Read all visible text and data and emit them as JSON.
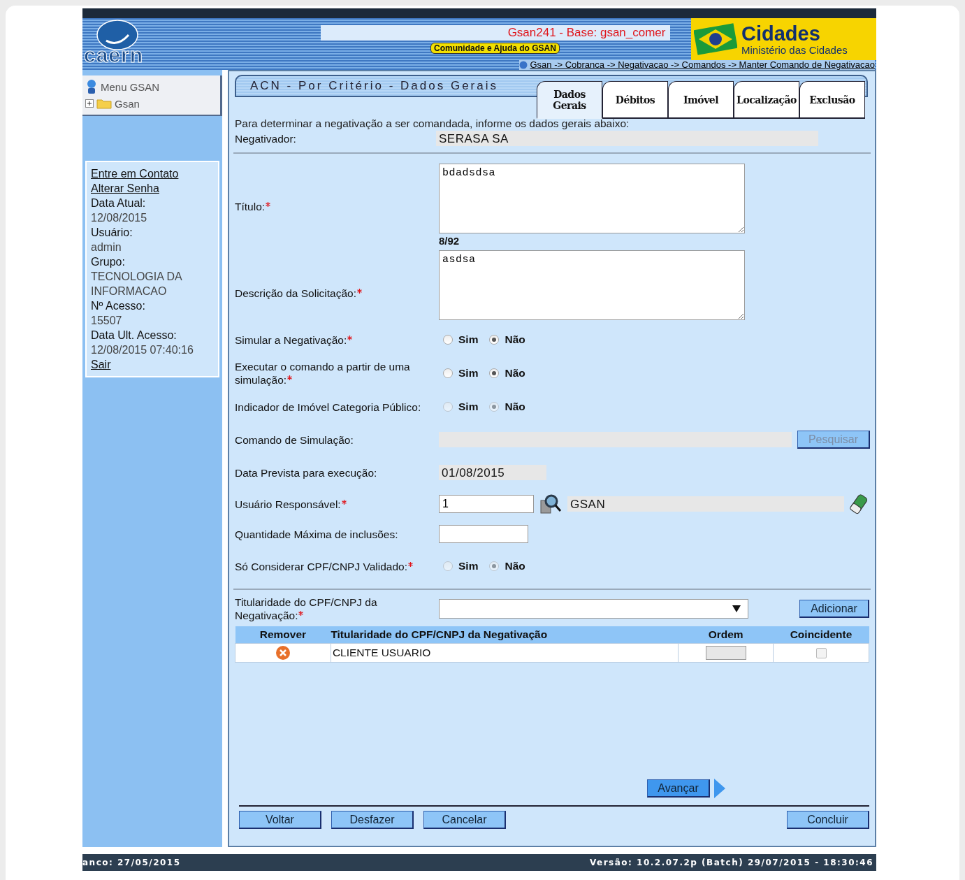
{
  "header": {
    "logo": "caern",
    "system_title": "Gsan241 - Base: gsan_comer",
    "help_link": "Comunidade e Ajuda do GSAN",
    "ministry_title": "Cidades",
    "ministry_subtitle": "Ministério das Cidades",
    "breadcrumb": "Gsan -> Cobranca -> Negativacao -> Comandos -> Manter Comando de Negativacao"
  },
  "sidebar": {
    "menu_title": "Menu GSAN",
    "tree": [
      {
        "label": "Gsan",
        "expanded": false
      }
    ],
    "links": [
      "Entre em Contato",
      "Alterar Senha"
    ],
    "info": [
      {
        "label": "Data Atual:",
        "value": "12/08/2015"
      },
      {
        "label": "Usuário:",
        "value": "admin"
      },
      {
        "label": "Grupo:",
        "value": "TECNOLOGIA DA INFORMACAO"
      },
      {
        "label": "Nº Acesso:",
        "value": "15507"
      },
      {
        "label": "Data Ult. Acesso:",
        "value": "12/08/2015 07:40:16"
      }
    ],
    "logout": "Sair"
  },
  "form": {
    "title": "ACN - Por Critério - Dados Gerais",
    "tabs": [
      {
        "label": "Dados Gerais",
        "selected": true
      },
      {
        "label": "Débitos",
        "selected": false
      },
      {
        "label": "Imóvel",
        "selected": false
      },
      {
        "label": "Localização",
        "selected": false
      },
      {
        "label": "Exclusão",
        "selected": false
      }
    ],
    "intro": "Para determinar a negativação a ser comandada, informe os dados gerais abaixo:",
    "negativador": {
      "label": "Negativador:",
      "value": "SERASA SA"
    },
    "fields": [
      {
        "kind": "textarea",
        "label": "Título:",
        "required": true,
        "value": "bdadsdsa",
        "counter": "8/92"
      },
      {
        "kind": "textarea",
        "label": "Descrição da Solicitação:",
        "required": true,
        "value": "asdsa"
      },
      {
        "kind": "radio",
        "label": "Simular a Negativação:",
        "required": true,
        "disabled": false,
        "options": [
          {
            "label": "Sim",
            "selected": false
          },
          {
            "label": "Não",
            "selected": true
          }
        ]
      },
      {
        "kind": "radio",
        "label": "Executar o comando a partir de uma simulação:",
        "required": true,
        "disabled": false,
        "options": [
          {
            "label": "Sim",
            "selected": false
          },
          {
            "label": "Não",
            "selected": true
          }
        ]
      },
      {
        "kind": "radio",
        "label": "Indicador de Imóvel Categoria Público:",
        "required": false,
        "disabled": true,
        "options": [
          {
            "label": "Sim",
            "selected": false
          },
          {
            "label": "Não",
            "selected": true
          }
        ]
      },
      {
        "kind": "search",
        "label": "Comando de Simulação:",
        "required": false,
        "button": "Pesquisar",
        "button_disabled": true
      },
      {
        "kind": "readonly",
        "label": "Data Prevista para execução:",
        "required": false,
        "value": "01/08/2015"
      },
      {
        "kind": "lookup",
        "label": "Usuário Responsável:",
        "required": true,
        "value": "1",
        "name": "GSAN"
      },
      {
        "kind": "input",
        "label": "Quantidade Máxima de inclusões:",
        "required": false
      },
      {
        "kind": "radio",
        "label": "Só Considerar CPF/CNPJ Validado:",
        "required": true,
        "disabled": true,
        "options": [
          {
            "label": "Sim",
            "selected": false
          },
          {
            "label": "Não",
            "selected": true
          }
        ]
      }
    ],
    "titularidade": {
      "label": "Titularidade do CPF/CNPJ da Negativação:",
      "required": true,
      "button": "Adicionar"
    },
    "table": {
      "columns": [
        "Remover",
        "Titularidade do CPF/CNPJ da Negativação",
        "Ordem",
        "Coincidente"
      ],
      "rows": [
        {
          "titularidade": "CLIENTE USUARIO",
          "coincidente": false
        }
      ]
    },
    "next_button": "Avançar",
    "nav_buttons": [
      "Voltar",
      "Desfazer",
      "Cancelar"
    ],
    "finish_button": "Concluir"
  },
  "status_bar": {
    "left": "anco: 27/05/2015",
    "right": "Versão: 10.2.07.2p (Batch) 29/07/2015 - 18:30:46"
  }
}
